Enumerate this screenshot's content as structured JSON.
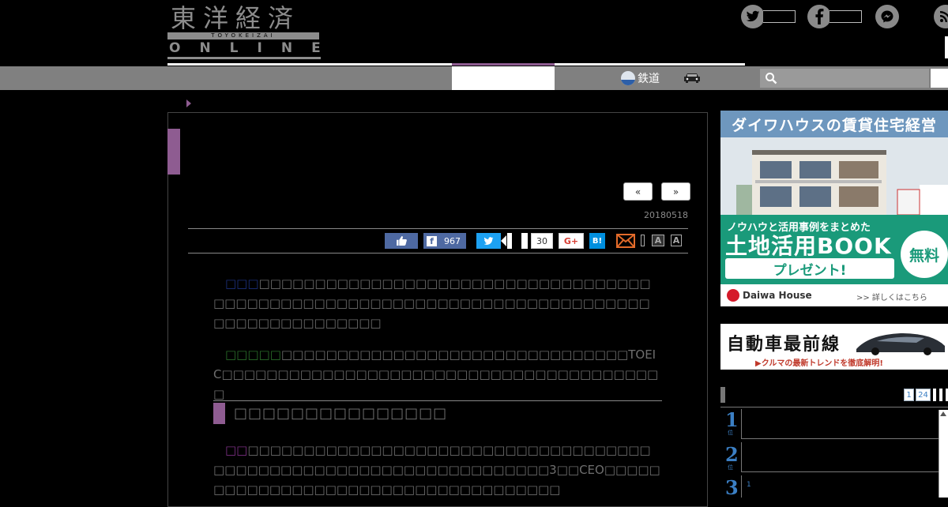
{
  "logo": {
    "jp": "東洋経済",
    "sub": "TOYOKEIZAI",
    "en": "ONLINE"
  },
  "nav": {
    "railway": "鉄道"
  },
  "article": {
    "pager_prev": "«",
    "pager_next": "»",
    "date": "20180518",
    "share": {
      "facebook_count": "967",
      "count": "30",
      "gplus": "G+",
      "hatena": "B!",
      "font_large": "A",
      "font_small": "A"
    },
    "toeic": "TOEIC",
    "three": "3",
    "ceo": "CEO"
  },
  "ad1": {
    "headline": "ダイワハウスの賃貸住宅経営",
    "line1": "ノウハウと活用事例をまとめた",
    "line2": "土地活用BOOK",
    "button": "プレゼント!",
    "badge": "無料",
    "brand": "Daiwa House",
    "more": ">> 詳しくはこちら"
  },
  "ad2": {
    "title": "自動車最前線",
    "subtitle": "▶クルマの最新トレンドを徹底解明!"
  },
  "ranking": {
    "page1": "1",
    "page2": "24",
    "items": [
      {
        "num": "1",
        "suffix": "位"
      },
      {
        "num": "2",
        "suffix": "位"
      },
      {
        "num": "3",
        "suffix": "1"
      }
    ]
  },
  "colors": {
    "accent": "#8e5c91",
    "nav_gray": "#808080",
    "facebook": "#4e69a2",
    "twitter": "#1da1f2",
    "hatena": "#008fde",
    "ad_green": "#1a9a7a",
    "rank_blue": "#3b7fc4"
  }
}
